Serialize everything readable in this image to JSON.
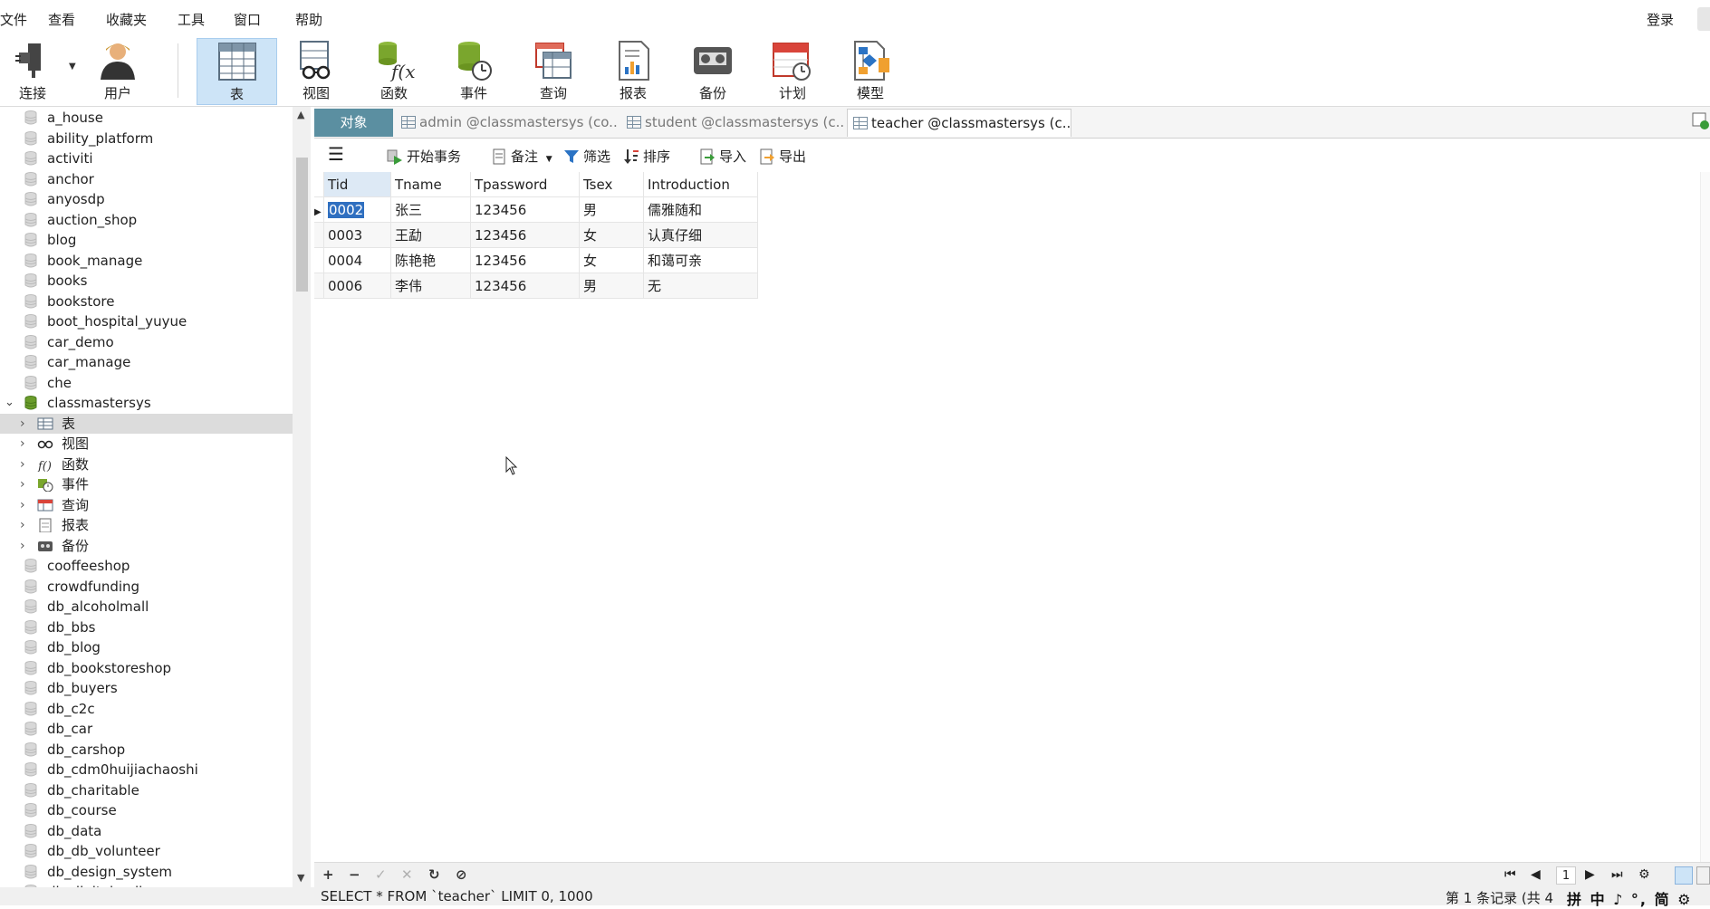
{
  "menubar": {
    "items": [
      "文件",
      "查看",
      "收藏夹",
      "工具",
      "窗口",
      "帮助"
    ],
    "login": "登录"
  },
  "toolbar": {
    "connect": "连接",
    "user": "用户",
    "table": "表",
    "view": "视图",
    "function": "函数",
    "event": "事件",
    "query": "查询",
    "report": "报表",
    "backup": "备份",
    "schedule": "计划",
    "model": "模型"
  },
  "sidebar": {
    "databases_top": [
      "a_house",
      "ability_platform",
      "activiti",
      "anchor",
      "anyosdp",
      "auction_shop",
      "blog",
      "book_manage",
      "books",
      "bookstore",
      "boot_hospital_yuyue",
      "car_demo",
      "car_manage",
      "che"
    ],
    "open_db": "classmastersys",
    "open_db_children": [
      "表",
      "视图",
      "函数",
      "事件",
      "查询",
      "报表",
      "备份"
    ],
    "databases_bottom": [
      "cooffeeshop",
      "crowdfunding",
      "db_alcoholmall",
      "db_bbs",
      "db_blog",
      "db_bookstoreshop",
      "db_buyers",
      "db_c2c",
      "db_car",
      "db_carshop",
      "db_cdm0huijiachaoshi",
      "db_charitable",
      "db_course",
      "db_data",
      "db_db_volunteer",
      "db_design_system",
      "db_digitalmall"
    ]
  },
  "tabs": {
    "objects": "对象",
    "tab1": "admin @classmastersys (co...",
    "tab2": "student @classmastersys (c...",
    "tab3": "teacher @classmastersys (c..."
  },
  "gridbar": {
    "begin_tx": "开始事务",
    "note": "备注",
    "filter": "筛选",
    "sort": "排序",
    "import": "导入",
    "export": "导出"
  },
  "table": {
    "columns": [
      "Tid",
      "Tname",
      "Tpassword",
      "Tsex",
      "Introduction"
    ],
    "rows": [
      [
        "0002",
        "张三",
        "123456",
        "男",
        "儒雅随和"
      ],
      [
        "0003",
        "王勐",
        "123456",
        "女",
        "认真仔细"
      ],
      [
        "0004",
        "陈艳艳",
        "123456",
        "女",
        "和蔼可亲"
      ],
      [
        "0006",
        "李伟",
        "123456",
        "男",
        "无"
      ]
    ]
  },
  "pager": {
    "page": "1"
  },
  "status": {
    "sql": "SELECT * FROM `teacher` LIMIT 0, 1000",
    "record": "第 1 条记录 (共 4",
    "ime": "拼 中 ♪ °, 简 ⚙"
  }
}
